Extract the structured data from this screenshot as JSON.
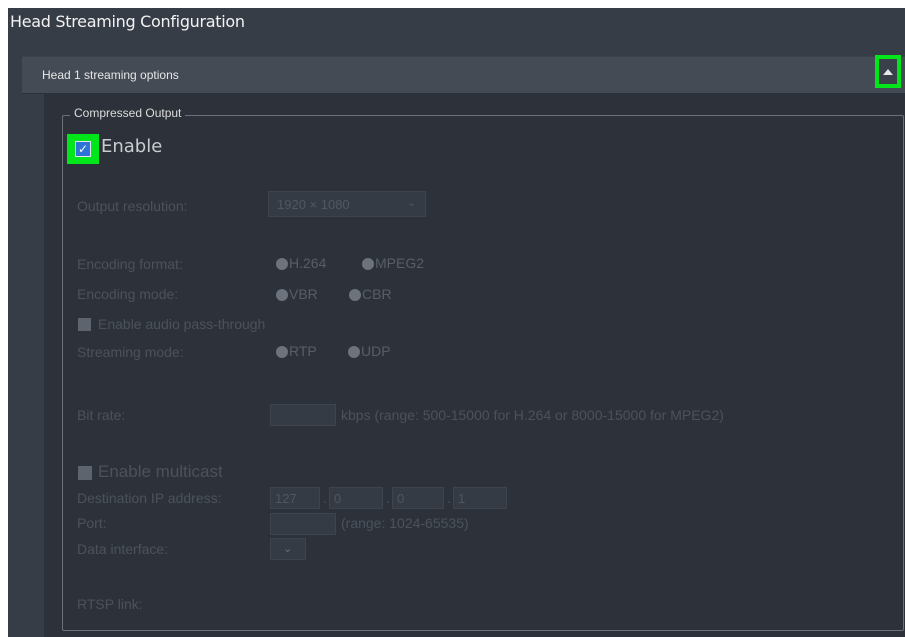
{
  "title": "Head Streaming Configuration",
  "section": {
    "label": "Head 1 streaming options",
    "collapse_icon": "triangle-up-icon"
  },
  "group": {
    "legend": "Compressed Output"
  },
  "enable": {
    "label": "Enable",
    "checked": true
  },
  "output_resolution": {
    "label": "Output resolution:",
    "value": "1920 × 1080",
    "chevron": "⌄"
  },
  "encoding_format": {
    "label": "Encoding format:",
    "options": [
      "H.264",
      "MPEG2"
    ]
  },
  "encoding_mode": {
    "label": "Encoding mode:",
    "options": [
      "VBR",
      "CBR"
    ]
  },
  "audio_passthrough": {
    "label": "Enable audio pass-through",
    "checked": false
  },
  "streaming_mode": {
    "label": "Streaming mode:",
    "options": [
      "RTP",
      "UDP"
    ]
  },
  "bit_rate": {
    "label": "Bit rate:",
    "value": "",
    "hint": "kbps (range: 500-15000 for H.264 or 8000-15000 for MPEG2)"
  },
  "multicast": {
    "label": "Enable multicast",
    "checked": false
  },
  "destination_ip": {
    "label": "Destination IP address:",
    "octets": [
      "127",
      "0",
      "0",
      "1"
    ],
    "sep": "."
  },
  "port": {
    "label": "Port:",
    "value": "",
    "hint": "(range: 1024-65535)"
  },
  "data_interface": {
    "label": "Data interface:",
    "chevron": "⌄"
  },
  "rtsp": {
    "label": "RTSP link:"
  },
  "colors": {
    "highlight": "#00e61a",
    "panel": "#373d47",
    "checkbox": "#2e74d6"
  }
}
